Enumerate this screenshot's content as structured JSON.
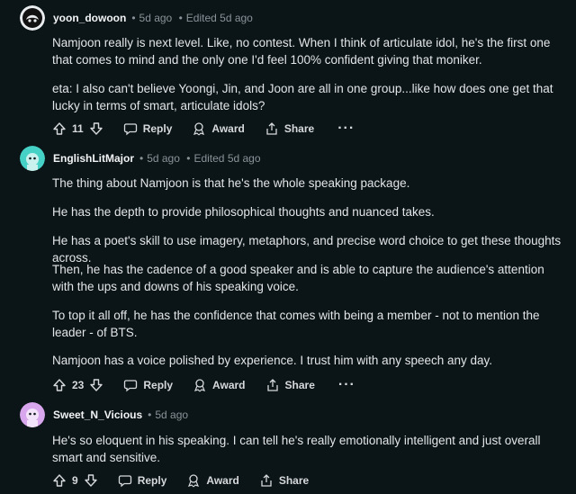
{
  "comments": [
    {
      "author": "yoon_dowoon",
      "separator": "•",
      "time": "5d ago",
      "edited": "Edited 5d ago",
      "paragraphs": [
        "Namjoon really is next level. Like, no contest. When I think of articulate idol, he's the first one that comes to mind and the only one I'd feel 100% confident giving that moniker.",
        "eta: I also can't believe Yoongi, Jin, and Joon are all in one group...like how does one get that lucky in terms of smart, articulate idols?"
      ],
      "votes": "11",
      "reply_label": "Reply",
      "award_label": "Award",
      "share_label": "Share",
      "more_label": "···",
      "avatar_color": "#e9ecee"
    },
    {
      "author": "EnglishLitMajor",
      "separator": "•",
      "time": "5d ago",
      "edited": "Edited 5d ago",
      "paragraphs": [
        "The thing about Namjoon is that he's the whole speaking package.",
        "He has the depth to provide philosophical thoughts and nuanced takes.",
        "He has a poet's skill to use imagery, metaphors, and precise word choice to get these thoughts across.",
        "Then, he has the cadence of a good speaker and is able to capture the audience's attention with the ups and downs of his speaking voice.",
        "To top it all off, he has the confidence that comes with being a member - not to mention the leader - of BTS.",
        "Namjoon has a voice polished by experience. I trust him with any speech any day."
      ],
      "votes": "23",
      "reply_label": "Reply",
      "award_label": "Award",
      "share_label": "Share",
      "more_label": "···",
      "avatar_color": "#46d1c7"
    },
    {
      "author": "Sweet_N_Vicious",
      "separator": "•",
      "time": "5d ago",
      "edited": "",
      "paragraphs": [
        "He's so eloquent in his speaking. I can tell he's really emotionally intelligent and just overall smart and sensitive."
      ],
      "votes": "9",
      "reply_label": "Reply",
      "award_label": "Award",
      "share_label": "Share",
      "more_label": "···",
      "avatar_color": "#d7a6ec"
    }
  ]
}
